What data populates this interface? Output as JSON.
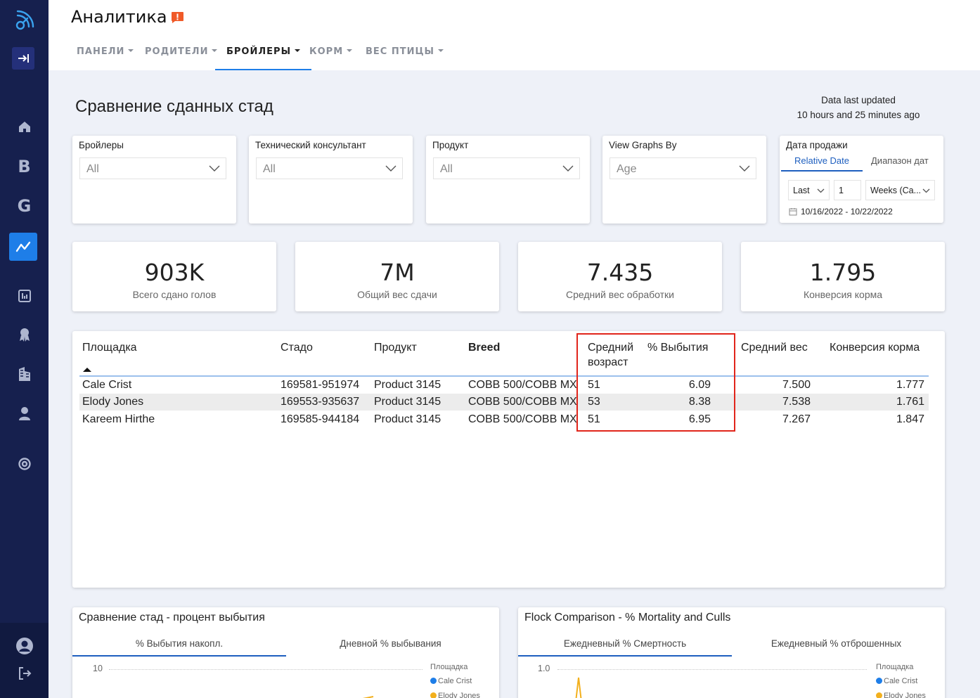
{
  "app": {
    "title": "Аналитика"
  },
  "nav": {
    "tabs": [
      {
        "label": "ПАНЕЛИ"
      },
      {
        "label": "РОДИТЕЛИ"
      },
      {
        "label": "БРОЙЛЕРЫ"
      },
      {
        "label": "КОРМ"
      },
      {
        "label": "ВЕС ПТИЦЫ"
      }
    ],
    "active_tab": "БРОЙЛЕРЫ"
  },
  "sidebar": {
    "letters": [
      "B",
      "G"
    ],
    "icons": [
      "logo-icon",
      "collapse-icon",
      "home-icon",
      "b-icon",
      "g-icon",
      "analytics-icon",
      "reports-icon",
      "awards-icon",
      "buildings-icon",
      "person-icon",
      "support-icon",
      "user-avatar-icon",
      "logout-icon"
    ]
  },
  "page": {
    "title": "Сравнение сданных стад",
    "updated_line1": "Data last updated",
    "updated_line2": "10 hours and 25 minutes ago"
  },
  "filters": [
    {
      "label": "Бройлеры",
      "value": "All"
    },
    {
      "label": "Технический консультант",
      "value": "All"
    },
    {
      "label": "Продукт",
      "value": "All"
    },
    {
      "label": "View Graphs By",
      "value": "Age"
    }
  ],
  "date_filter": {
    "label": "Дата продажи",
    "tab_relative": "Relative Date",
    "tab_range": "Диапазон дат",
    "mode": "Last",
    "count": "1",
    "unit": "Weeks (Ca...",
    "range": "10/16/2022 - 10/22/2022"
  },
  "kpis": [
    {
      "value": "903K",
      "label": "Всего сдано голов"
    },
    {
      "value": "7M",
      "label": "Общий вес сдачи"
    },
    {
      "value": "7.435",
      "label": "Средний вес обработки"
    },
    {
      "value": "1.795",
      "label": "Конверсия корма"
    }
  ],
  "table": {
    "columns": [
      "Площадка",
      "Стадо",
      "Продукт",
      "Breed",
      "Средний",
      "возраст",
      "% Выбытия",
      "Средний вес",
      "Конверсия корма"
    ],
    "rows": [
      {
        "site": "Cale Crist",
        "flock": "169581-951974",
        "product": "Product 3145",
        "breed": "COBB 500/COBB MX",
        "age": "51",
        "mortality": "6.09",
        "weight": "7.500",
        "fcr": "1.777"
      },
      {
        "site": "Elody Jones",
        "flock": "169553-935637",
        "product": "Product 3145",
        "breed": "COBB 500/COBB MX",
        "age": "53",
        "mortality": "8.38",
        "weight": "7.538",
        "fcr": "1.761"
      },
      {
        "site": "Kareem Hirthe",
        "flock": "169585-944184",
        "product": "Product 3145",
        "breed": "COBB 500/COBB MX",
        "age": "51",
        "mortality": "6.95",
        "weight": "7.267",
        "fcr": "1.847"
      }
    ]
  },
  "charts": {
    "left": {
      "title": "Сравнение стад - процент выбытия",
      "tab1": "% Выбытия накопл.",
      "tab2": "Дневной % выбывания",
      "y_tick": "10",
      "legend_title": "Площадка",
      "legend": [
        "Cale Crist",
        "Elody Jones"
      ]
    },
    "right": {
      "title": "Flock Comparison - % Mortality and Culls",
      "tab1": "Ежедневный % Смертность",
      "tab2": "Ежедневный % отброшенных",
      "y_tick": "1.0",
      "legend_title": "Площадка",
      "legend": [
        "Cale Crist",
        "Elody Jones"
      ]
    }
  },
  "colors": {
    "sidebar": "#16204e",
    "accent": "#1e7ee8",
    "highlight": "#e1251b",
    "series_cale": "#1e7ee8",
    "series_elody": "#f2b01e"
  }
}
